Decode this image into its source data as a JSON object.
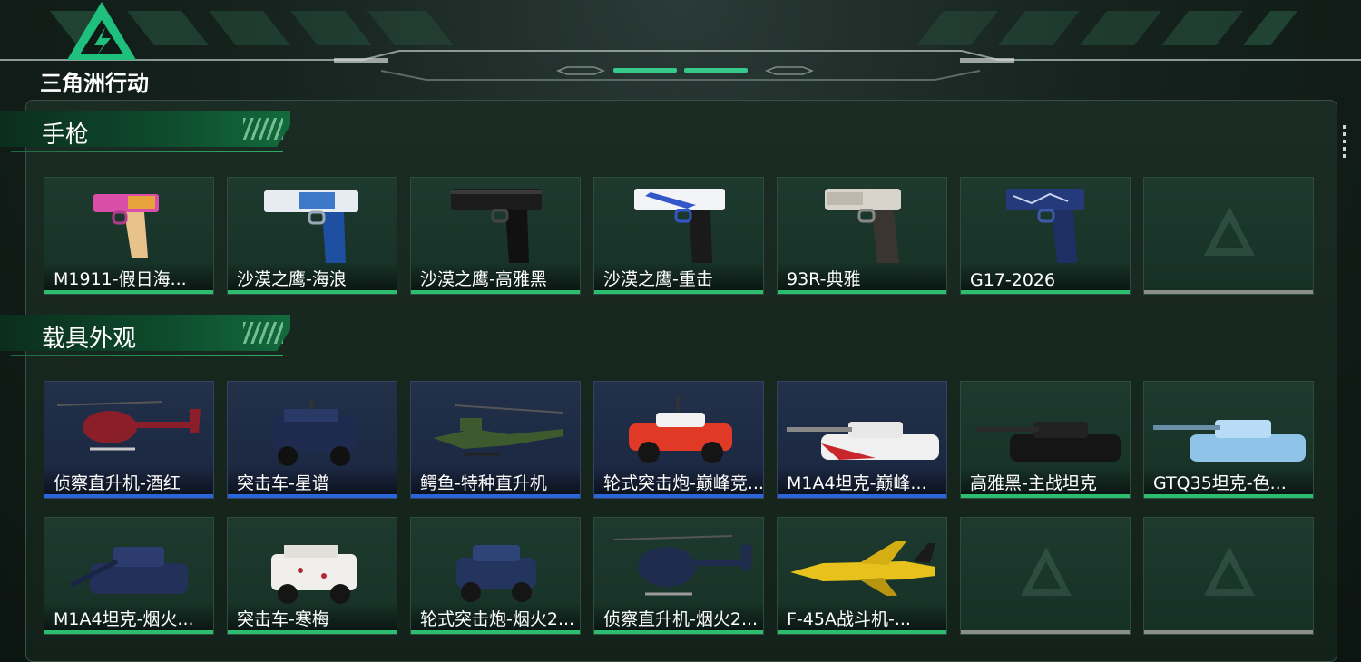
{
  "brand": {
    "logo_text": "三角洲行动"
  },
  "sections": [
    {
      "title": "手枪",
      "items": [
        {
          "name": "M1911-假日海...",
          "theme": "green"
        },
        {
          "name": "沙漠之鹰-海浪",
          "theme": "green"
        },
        {
          "name": "沙漠之鹰-高雅黑",
          "theme": "green"
        },
        {
          "name": "沙漠之鹰-重击",
          "theme": "green"
        },
        {
          "name": "93R-典雅",
          "theme": "green"
        },
        {
          "name": "G17-2026",
          "theme": "green"
        },
        {
          "name": "",
          "theme": "empty"
        }
      ]
    },
    {
      "title": "载具外观",
      "items": [
        {
          "name": "侦察直升机-酒红",
          "theme": "blue"
        },
        {
          "name": "突击车-星谱",
          "theme": "blue"
        },
        {
          "name": "鳄鱼-特种直升机",
          "theme": "blue"
        },
        {
          "name": "轮式突击炮-巅峰竞...",
          "theme": "blue"
        },
        {
          "name": "M1A4坦克-巅峰...",
          "theme": "blue"
        },
        {
          "name": "高雅黑-主战坦克",
          "theme": "green"
        },
        {
          "name": "GTQ35坦克-色...",
          "theme": "green"
        },
        {
          "name": "M1A4坦克-烟火...",
          "theme": "green"
        },
        {
          "name": "突击车-寒梅",
          "theme": "green"
        },
        {
          "name": "轮式突击炮-烟火2...",
          "theme": "green"
        },
        {
          "name": "侦察直升机-烟火2...",
          "theme": "green"
        },
        {
          "name": "F-45A战斗机-...",
          "theme": "green"
        },
        {
          "name": "",
          "theme": "empty"
        },
        {
          "name": "",
          "theme": "empty"
        }
      ]
    }
  ],
  "colors": {
    "accent_green": "#2dbd6e",
    "accent_blue": "#2a66d8",
    "empty_gray": "#8a8f8c"
  },
  "icons": [
    "delta-logo-icon",
    "pistol-icon",
    "helicopter-icon",
    "armored-car-icon",
    "tank-icon",
    "fighter-jet-icon",
    "delta-watermark-icon"
  ]
}
